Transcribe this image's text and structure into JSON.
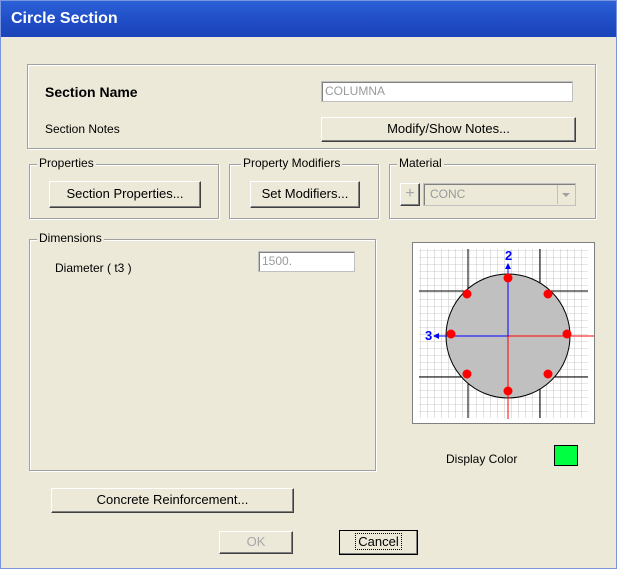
{
  "window": {
    "title": "Circle Section"
  },
  "section": {
    "name_label": "Section Name",
    "name_value": "COLUMNA",
    "notes_label": "Section Notes",
    "notes_button": "Modify/Show Notes..."
  },
  "properties": {
    "legend": "Properties",
    "button": "Section Properties..."
  },
  "modifiers": {
    "legend": "Property Modifiers",
    "button": "Set Modifiers..."
  },
  "material": {
    "legend": "Material",
    "add_symbol": "+",
    "selected": "CONC"
  },
  "dimensions": {
    "legend": "Dimensions",
    "diameter_label": "Diameter  ( t3 )",
    "diameter_value": "1500."
  },
  "preview": {
    "axis2_label": "2",
    "axis3_label": "3"
  },
  "display_color": {
    "label": "Display Color",
    "color": "#00ff40"
  },
  "reinforcement_button": "Concrete Reinforcement...",
  "footer": {
    "ok": "OK",
    "cancel": "Cancel"
  },
  "colors": {
    "title_bar": "#1f4bc4",
    "dialog_bg": "#ece9d8",
    "rebar": "#ff0000",
    "axis2": "#0000ff",
    "axis3": "#ff0000"
  }
}
